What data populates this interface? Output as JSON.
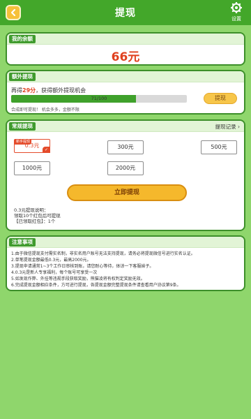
{
  "header": {
    "title": "提现",
    "settings_label": "设置"
  },
  "balance": {
    "section_title": "我的余额",
    "amount": "66元"
  },
  "extra": {
    "section_title": "额外提现",
    "text_prefix": "再得",
    "text_count": "29分",
    "text_suffix": "，获得额外提现机会",
    "progress_text": "71/100",
    "progress_fraction": 0.71,
    "tip": "合成即可提现！ 机会多多，金额不限",
    "button_label": "提现"
  },
  "regular": {
    "section_title": "常规提现",
    "record_link": "提现记录",
    "newbie_tag": "新手提现",
    "amounts": [
      "0.3元",
      "300元",
      "500元",
      "1000元",
      "2000元"
    ],
    "selected_index": 0,
    "withdraw_label": "立即提现",
    "rule_title": "0.3元提现说明：",
    "rule_line1": "领取10个红包后可提现",
    "rule_line2": "【已领取红包】：1个"
  },
  "notes": {
    "section_title": "注意事项",
    "items": [
      "1.由于微信提现支付需实名制，非实名用户账号无法支持提现，请务必将提现微信号进行实名认证。",
      "2.单笔提现金额最低0.3元，最高2000元。",
      "3.提现申请通常1~3个工作日审核到账，请您耐心等待，体谅一下客服妹子。",
      "4.0.3元是新人专享福利，每个账号可享受一次",
      "5.如发现作弊、外挂等违规手段获取奖励，熊猫凌将有权判定奖励无效。",
      "6.完成提现金额相应条件，方可进行提现，各提现金额完整提现条件请查看用户协议第9条。"
    ]
  },
  "colors": {
    "background": "#8fd66c",
    "header": "#43a72a",
    "accent_red": "#e0401e",
    "button_yellow": "#f5b82c"
  }
}
